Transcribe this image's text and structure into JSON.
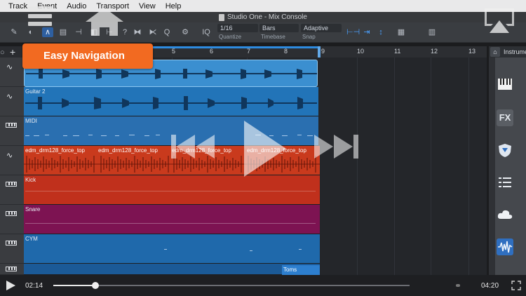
{
  "menubar": {
    "items": [
      "Track",
      "Event",
      "Audio",
      "Transport",
      "View",
      "Help"
    ]
  },
  "window": {
    "title": "Studio One - Mix Console"
  },
  "toolbar": {
    "quantize": {
      "value": "1/16",
      "label": "Quantize"
    },
    "timebase": {
      "value": "Bars",
      "label": "Timebase"
    },
    "snap": {
      "value": "Adaptive",
      "label": "Snap"
    },
    "iq_label": "IQ"
  },
  "ruler": {
    "bars": [
      "5",
      "6",
      "7",
      "8",
      "9",
      "10",
      "11",
      "12",
      "13"
    ]
  },
  "tracks": [
    {
      "name": "",
      "type": "audio",
      "color": "#2f86c8"
    },
    {
      "name": "Guitar 2",
      "type": "audio",
      "color": "#2274b8"
    },
    {
      "name": "MIDI",
      "type": "instrument",
      "color": "#2a6fb0"
    },
    {
      "name": "",
      "type": "audio",
      "color": "#c93a1d"
    },
    {
      "name": "Kick",
      "type": "instrument",
      "color": "#c0301c"
    },
    {
      "name": "Snare",
      "type": "instrument",
      "color": "#7d1352"
    },
    {
      "name": "CYM",
      "type": "instrument",
      "color": "#1f69ab"
    },
    {
      "name": "Toms",
      "type": "instrument",
      "color": "#2d7fcf"
    }
  ],
  "events": {
    "drum_labels": [
      "edm_drm128_force_top",
      "edm_drm128_force_top",
      "edm_drm128_force_top",
      "edm_drm128_force_top"
    ],
    "toms_label": "Toms"
  },
  "sidebar": {
    "tab_label": "Instrume",
    "buttons": [
      "keyboard-icon",
      "fx-icon",
      "shield-icon",
      "list-icon",
      "cloud-icon",
      "waveform-icon"
    ],
    "fx_label": "FX"
  },
  "overlay": {
    "callout": "Easy Navigation"
  },
  "player": {
    "elapsed": "02:14",
    "duration": "04:20",
    "progress": 0.118
  },
  "colors": {
    "accent": "#f26a21",
    "loop": "#63a9e8",
    "audio_blue": "#2f86c8",
    "drum_red": "#c93a1d",
    "snare_purple": "#7d1352"
  }
}
